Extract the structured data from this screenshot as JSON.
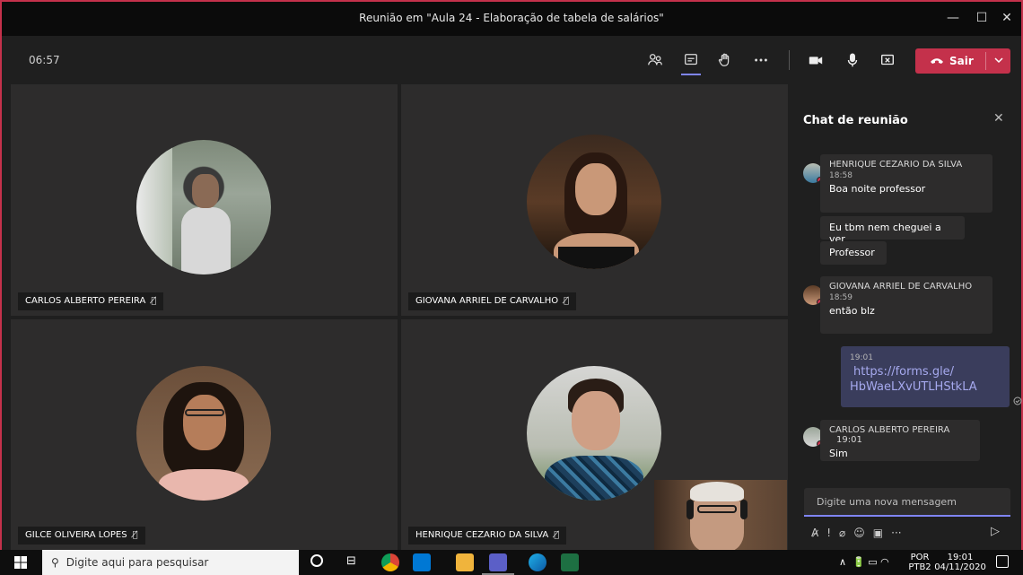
{
  "window": {
    "title": "Reunião em \"Aula 24 - Elaboração de tabela de salários\"",
    "controls": {
      "minimize": "—",
      "maximize": "☐",
      "close": "✕"
    }
  },
  "toolbar": {
    "timer": "06:57",
    "leave_label": "Sair",
    "icons": [
      "participants-icon",
      "chat-icon",
      "raise-hand-icon",
      "more-icon",
      "camera-icon",
      "microphone-icon",
      "share-screen-icon"
    ]
  },
  "participants": [
    {
      "name": "CARLOS ALBERTO PEREIRA"
    },
    {
      "name": "GIOVANA ARRIEL DE CARVALHO"
    },
    {
      "name": "GILCE OLIVEIRA LOPES"
    },
    {
      "name": "HENRIQUE CEZARIO DA SILVA"
    }
  ],
  "chat": {
    "title": "Chat de reunião",
    "messages": [
      {
        "author": "HENRIQUE CEZARIO DA SILVA",
        "time": "18:58",
        "lines": [
          "Boa noite professor",
          "Eu tbm nem cheguei a ver",
          "Professor"
        ]
      },
      {
        "author": "GIOVANA ARRIEL DE CARVALHO",
        "time": "18:59",
        "lines": [
          "então blz"
        ]
      },
      {
        "author": "",
        "time": "19:01",
        "link_1": "https://forms.gle/",
        "link_2": "HbWaeLXvUTLHStkLA"
      },
      {
        "author": "CARLOS ALBERTO PEREIRA",
        "time": "19:01",
        "lines": [
          "Sim"
        ]
      }
    ],
    "compose_placeholder": "Digite uma nova mensagem"
  },
  "taskbar": {
    "search_placeholder": "Digite aqui para pesquisar",
    "lang": "POR",
    "lang_sub": "PTB2",
    "time": "19:01",
    "date": "04/11/2020"
  },
  "colors": {
    "accent": "#c4314b",
    "brand": "#7f85f5",
    "tile": "#2d2c2c"
  }
}
